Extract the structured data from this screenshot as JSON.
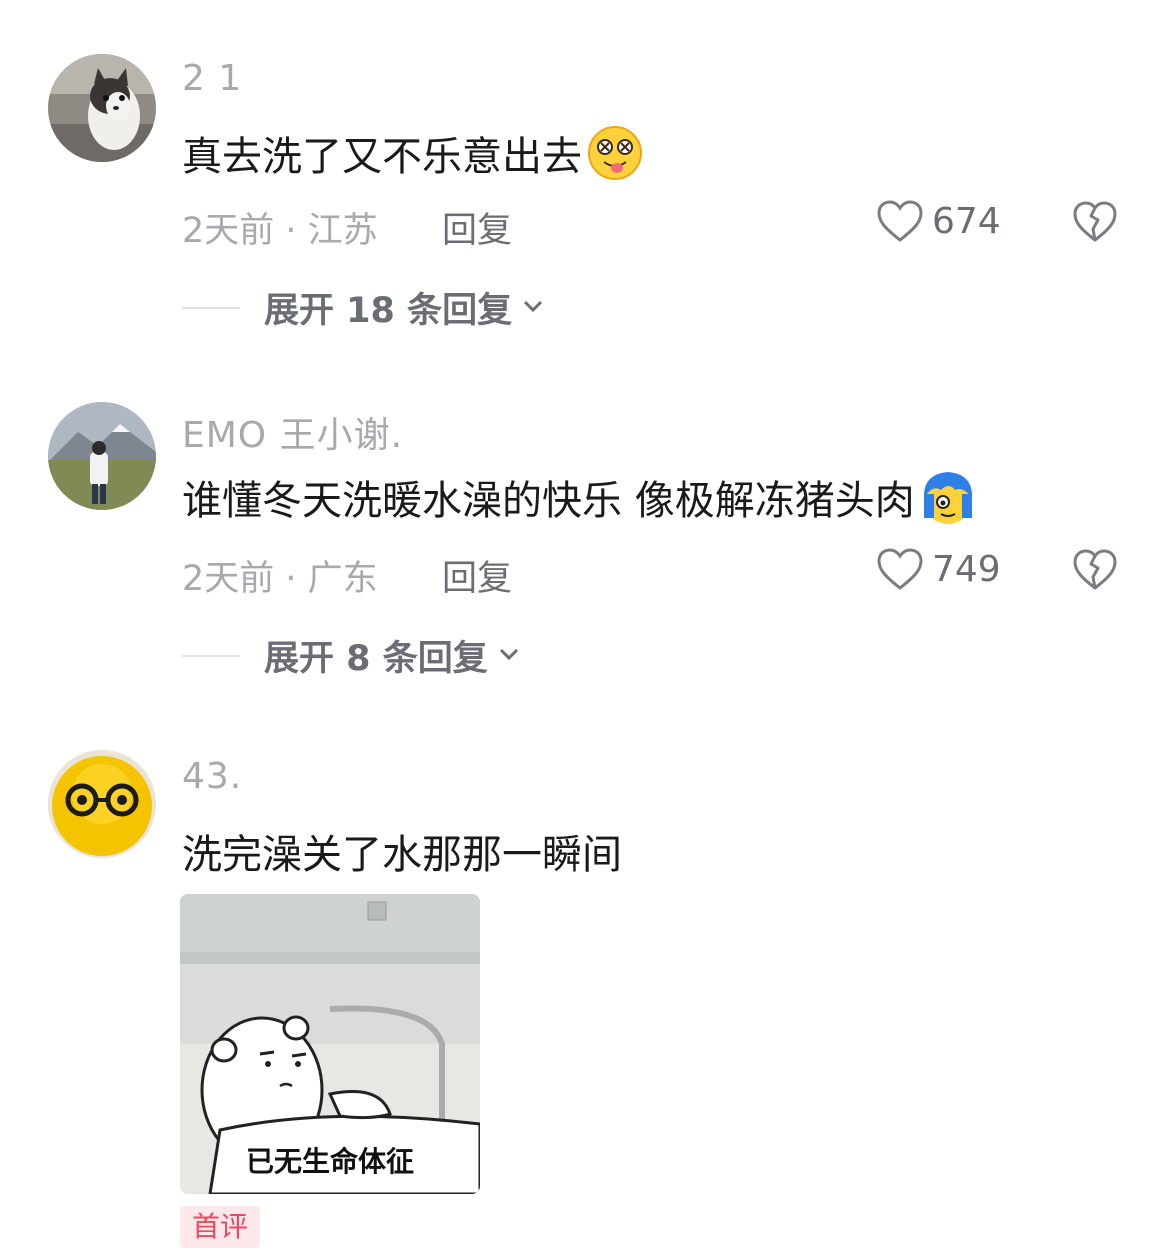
{
  "colors": {
    "muted": "#a8a9ae",
    "secondary": "#6b6d74",
    "badge_text": "#f0475c",
    "badge_bg": "#fde9ec"
  },
  "comments": [
    {
      "username": "2 1",
      "text": "真去洗了又不乐意出去",
      "emoji": "dizzy-tongue-face-emoji",
      "time_location": "2天前 · 江苏",
      "reply_label": "回复",
      "likes": "674",
      "expand_label": "展开 18 条回复",
      "avatar": "cat-photo"
    },
    {
      "username": "EMO 王小谢.",
      "text": "谁懂冬天洗暖水澡的快乐 像极解冻猪头肉",
      "emoji": "blue-hair-face-emoji",
      "time_location": "2天前 · 广东",
      "reply_label": "回复",
      "likes": "749",
      "expand_label": "展开 8 条回复",
      "avatar": "mountain-person-photo"
    },
    {
      "username": "43.",
      "text": "洗完澡关了水那那一瞬间",
      "sticker_caption": "已无生命体征",
      "badge": "首评",
      "avatar": "yellow-glasses-face"
    }
  ]
}
